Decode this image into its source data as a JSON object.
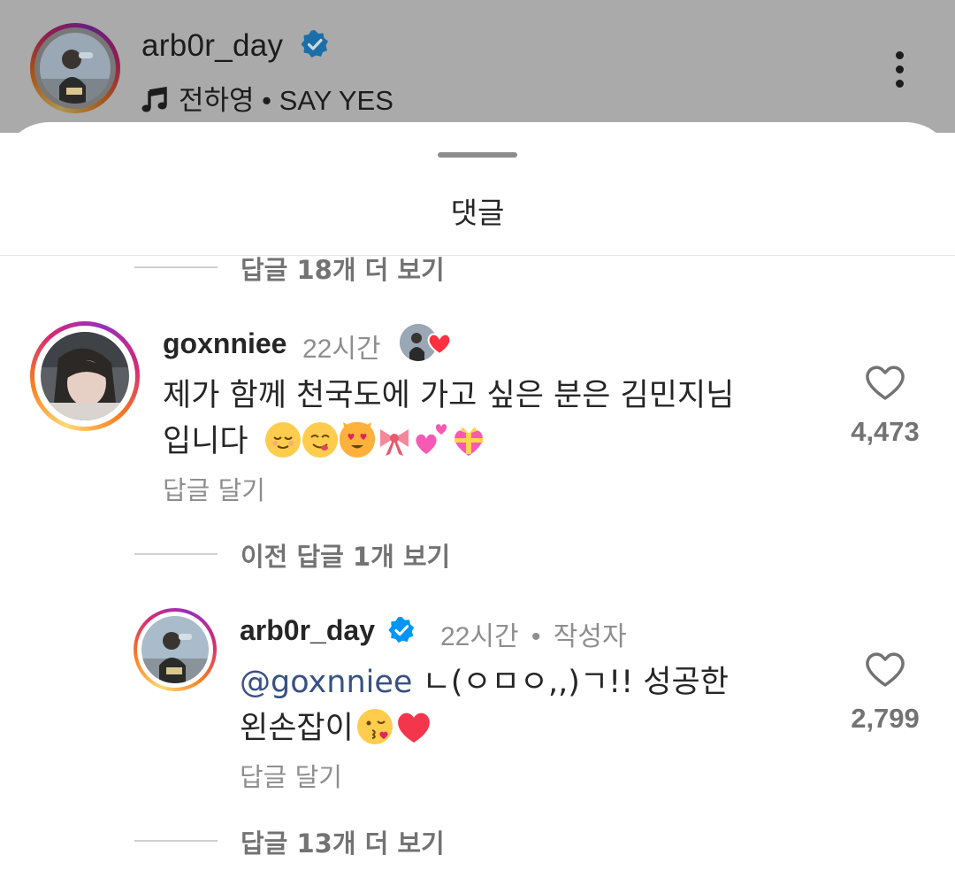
{
  "post": {
    "username": "arb0r_day",
    "verified": true,
    "music": "전하영 • SAY YES",
    "more_icon": "more-vertical-icon"
  },
  "sheet": {
    "title": "댓글"
  },
  "view_more_top": "답글 18개 더 보기",
  "comments": [
    {
      "username": "goxnniee",
      "time": "22시간",
      "creator_liked": true,
      "text_line1": "제가 함께 천국도에 가고 싶은 분은 김민지님",
      "text_line2": "입니다",
      "emojis": [
        "relieved-face",
        "yum-face",
        "heart-eyes-cat",
        "ribbon",
        "two-hearts",
        "gift-heart"
      ],
      "reply_label": "답글 달기",
      "likes": "4,473"
    }
  ],
  "view_previous": "이전 답글 1개 보기",
  "reply": {
    "username": "arb0r_day",
    "verified": true,
    "time": "22시간",
    "separator": "•",
    "author_badge": "작성자",
    "mention": "@goxnniee",
    "text_line1": " ㄴ(ㅇㅁㅇ,,)ㄱ!! 성공한",
    "text_line2": "왼손잡이",
    "emojis": [
      "kissing-heart-face",
      "red-heart"
    ],
    "reply_label": "답글 달기",
    "likes": "2,799"
  },
  "view_more_bottom": "답글 13개 더 보기",
  "colors": {
    "verified_blue": "#0095f6",
    "mention": "#385185",
    "secondary_text": "#8e8e8e",
    "heart_red": "#ff3040"
  }
}
